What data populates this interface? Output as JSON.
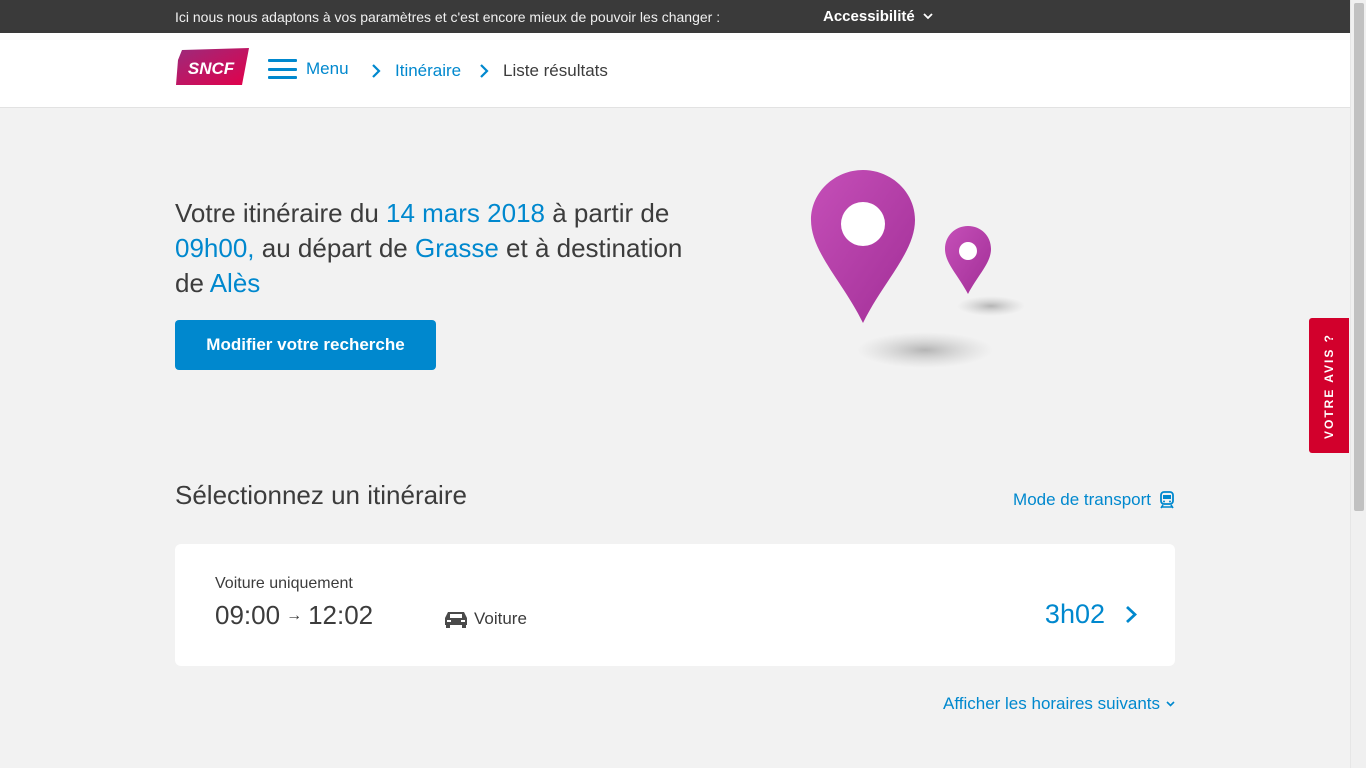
{
  "topbar": {
    "message": "Ici nous nous adaptons à vos paramètres et c'est encore mieux de pouvoir les changer :",
    "accessibility_label": "Accessibilité"
  },
  "header": {
    "logo_text": "SNCF",
    "menu_label": "Menu",
    "breadcrumb": [
      "Itinéraire",
      "Liste résultats"
    ]
  },
  "hero": {
    "t1": "Votre itinéraire du ",
    "date": "14 mars 2018",
    "t2": " à partir de ",
    "time": "09h00,",
    "t3": " au départ de ",
    "origin": "Grasse",
    "t4": " et à destination de ",
    "destination": "Alès",
    "modify_button": "Modifier votre recherche"
  },
  "feedback_label": "VOTRE AVIS ?",
  "section": {
    "title": "Sélectionnez un itinéraire",
    "transport_mode_label": "Mode de transport"
  },
  "results": [
    {
      "label": "Voiture uniquement",
      "departure": "09:00",
      "arrow": "→",
      "arrival": "12:02",
      "mode": "Voiture",
      "duration": "3h02"
    }
  ],
  "next_times_label": "Afficher les horaires suivants",
  "colors": {
    "accent": "#0088ce",
    "feedback": "#d2002c",
    "pin": "#b53aa8",
    "topbar": "#3a3a3a"
  }
}
